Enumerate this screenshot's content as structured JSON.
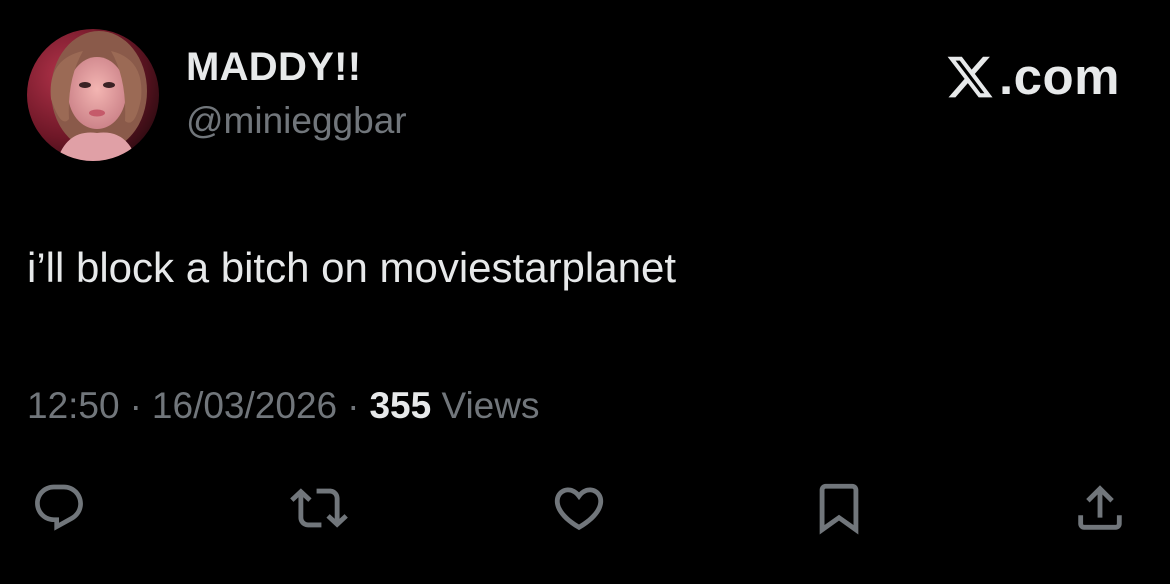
{
  "author": {
    "display_name": "MADDY!!",
    "handle": "@minieggbar",
    "avatar_icon": "profile-photo"
  },
  "site": {
    "label": ".com",
    "logo_icon": "x-logo-icon"
  },
  "tweet": {
    "text": "i’ll block a bitch on moviestarplanet",
    "time": "12:50",
    "date": "16/03/2026",
    "separator": "·",
    "views_count": "355",
    "views_label": "Views"
  },
  "actions": [
    {
      "name": "reply",
      "icon": "reply-icon"
    },
    {
      "name": "repost",
      "icon": "repost-icon"
    },
    {
      "name": "like",
      "icon": "heart-icon"
    },
    {
      "name": "bookmark",
      "icon": "bookmark-icon"
    },
    {
      "name": "share",
      "icon": "share-icon"
    }
  ],
  "colors": {
    "background": "#000000",
    "primary_text": "#e7e9ea",
    "secondary_text": "#71767b"
  }
}
